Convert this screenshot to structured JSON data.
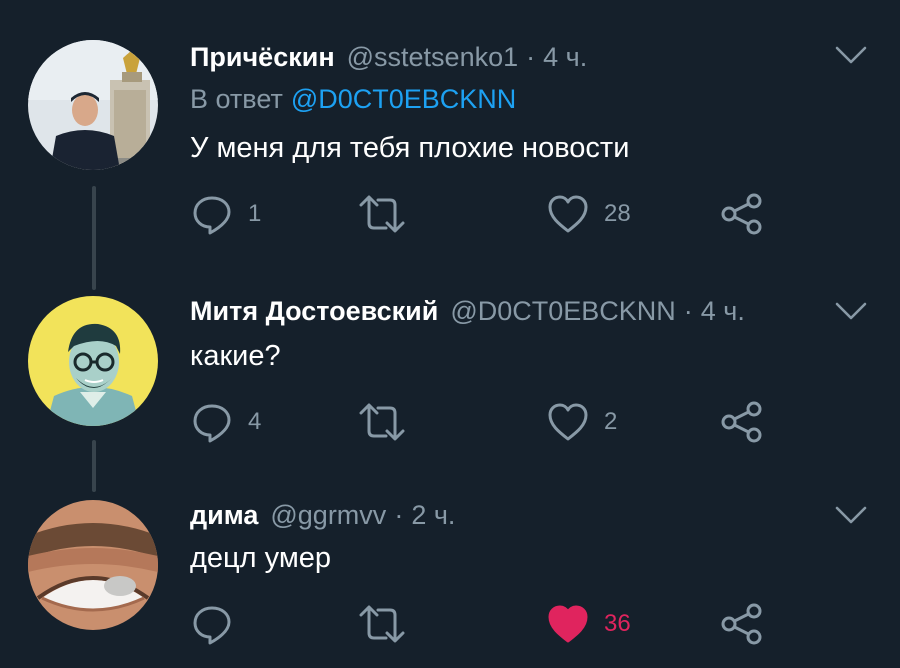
{
  "tweets": [
    {
      "name": "Причёскин",
      "handle": "@sstetsenko1",
      "separator": "·",
      "time": "4 ч.",
      "reply_prefix": "В ответ",
      "reply_mention": "@D0CT0EBCKNN",
      "text": "У меня для тебя плохие новости",
      "reply_count": "1",
      "retweet_count": "",
      "like_count": "28",
      "liked": false
    },
    {
      "name": "Митя Достоевский",
      "handle": "@D0CT0EBCKNN",
      "separator": "·",
      "time": "4 ч.",
      "text": "какие?",
      "reply_count": "4",
      "retweet_count": "",
      "like_count": "2",
      "liked": false
    },
    {
      "name": "дима",
      "handle": "@ggrmvv",
      "separator": "·",
      "time": "2 ч.",
      "text": "децл умер",
      "reply_count": "",
      "retweet_count": "",
      "like_count": "36",
      "liked": true
    }
  ],
  "colors": {
    "background": "#15202b",
    "secondary_text": "#8899a6",
    "link": "#1da1f2",
    "like_active": "#e0245e",
    "thread_line": "#38444d"
  },
  "icons": [
    "reply-icon",
    "retweet-icon",
    "like-icon",
    "share-icon",
    "chevron-down-icon"
  ]
}
